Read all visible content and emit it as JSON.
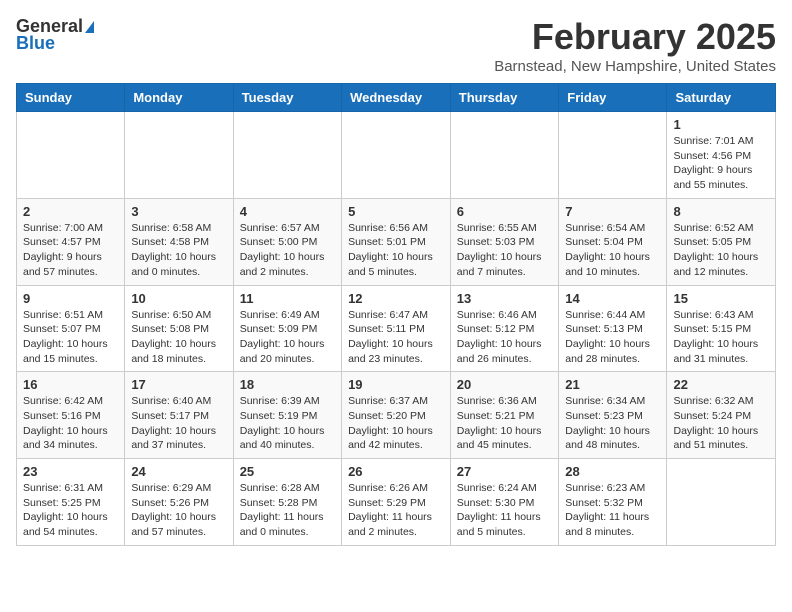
{
  "header": {
    "logo_general": "General",
    "logo_blue": "Blue",
    "title": "February 2025",
    "location": "Barnstead, New Hampshire, United States"
  },
  "days_of_week": [
    "Sunday",
    "Monday",
    "Tuesday",
    "Wednesday",
    "Thursday",
    "Friday",
    "Saturday"
  ],
  "weeks": [
    [
      {
        "day": "",
        "info": ""
      },
      {
        "day": "",
        "info": ""
      },
      {
        "day": "",
        "info": ""
      },
      {
        "day": "",
        "info": ""
      },
      {
        "day": "",
        "info": ""
      },
      {
        "day": "",
        "info": ""
      },
      {
        "day": "1",
        "info": "Sunrise: 7:01 AM\nSunset: 4:56 PM\nDaylight: 9 hours and 55 minutes."
      }
    ],
    [
      {
        "day": "2",
        "info": "Sunrise: 7:00 AM\nSunset: 4:57 PM\nDaylight: 9 hours and 57 minutes."
      },
      {
        "day": "3",
        "info": "Sunrise: 6:58 AM\nSunset: 4:58 PM\nDaylight: 10 hours and 0 minutes."
      },
      {
        "day": "4",
        "info": "Sunrise: 6:57 AM\nSunset: 5:00 PM\nDaylight: 10 hours and 2 minutes."
      },
      {
        "day": "5",
        "info": "Sunrise: 6:56 AM\nSunset: 5:01 PM\nDaylight: 10 hours and 5 minutes."
      },
      {
        "day": "6",
        "info": "Sunrise: 6:55 AM\nSunset: 5:03 PM\nDaylight: 10 hours and 7 minutes."
      },
      {
        "day": "7",
        "info": "Sunrise: 6:54 AM\nSunset: 5:04 PM\nDaylight: 10 hours and 10 minutes."
      },
      {
        "day": "8",
        "info": "Sunrise: 6:52 AM\nSunset: 5:05 PM\nDaylight: 10 hours and 12 minutes."
      }
    ],
    [
      {
        "day": "9",
        "info": "Sunrise: 6:51 AM\nSunset: 5:07 PM\nDaylight: 10 hours and 15 minutes."
      },
      {
        "day": "10",
        "info": "Sunrise: 6:50 AM\nSunset: 5:08 PM\nDaylight: 10 hours and 18 minutes."
      },
      {
        "day": "11",
        "info": "Sunrise: 6:49 AM\nSunset: 5:09 PM\nDaylight: 10 hours and 20 minutes."
      },
      {
        "day": "12",
        "info": "Sunrise: 6:47 AM\nSunset: 5:11 PM\nDaylight: 10 hours and 23 minutes."
      },
      {
        "day": "13",
        "info": "Sunrise: 6:46 AM\nSunset: 5:12 PM\nDaylight: 10 hours and 26 minutes."
      },
      {
        "day": "14",
        "info": "Sunrise: 6:44 AM\nSunset: 5:13 PM\nDaylight: 10 hours and 28 minutes."
      },
      {
        "day": "15",
        "info": "Sunrise: 6:43 AM\nSunset: 5:15 PM\nDaylight: 10 hours and 31 minutes."
      }
    ],
    [
      {
        "day": "16",
        "info": "Sunrise: 6:42 AM\nSunset: 5:16 PM\nDaylight: 10 hours and 34 minutes."
      },
      {
        "day": "17",
        "info": "Sunrise: 6:40 AM\nSunset: 5:17 PM\nDaylight: 10 hours and 37 minutes."
      },
      {
        "day": "18",
        "info": "Sunrise: 6:39 AM\nSunset: 5:19 PM\nDaylight: 10 hours and 40 minutes."
      },
      {
        "day": "19",
        "info": "Sunrise: 6:37 AM\nSunset: 5:20 PM\nDaylight: 10 hours and 42 minutes."
      },
      {
        "day": "20",
        "info": "Sunrise: 6:36 AM\nSunset: 5:21 PM\nDaylight: 10 hours and 45 minutes."
      },
      {
        "day": "21",
        "info": "Sunrise: 6:34 AM\nSunset: 5:23 PM\nDaylight: 10 hours and 48 minutes."
      },
      {
        "day": "22",
        "info": "Sunrise: 6:32 AM\nSunset: 5:24 PM\nDaylight: 10 hours and 51 minutes."
      }
    ],
    [
      {
        "day": "23",
        "info": "Sunrise: 6:31 AM\nSunset: 5:25 PM\nDaylight: 10 hours and 54 minutes."
      },
      {
        "day": "24",
        "info": "Sunrise: 6:29 AM\nSunset: 5:26 PM\nDaylight: 10 hours and 57 minutes."
      },
      {
        "day": "25",
        "info": "Sunrise: 6:28 AM\nSunset: 5:28 PM\nDaylight: 11 hours and 0 minutes."
      },
      {
        "day": "26",
        "info": "Sunrise: 6:26 AM\nSunset: 5:29 PM\nDaylight: 11 hours and 2 minutes."
      },
      {
        "day": "27",
        "info": "Sunrise: 6:24 AM\nSunset: 5:30 PM\nDaylight: 11 hours and 5 minutes."
      },
      {
        "day": "28",
        "info": "Sunrise: 6:23 AM\nSunset: 5:32 PM\nDaylight: 11 hours and 8 minutes."
      },
      {
        "day": "",
        "info": ""
      }
    ]
  ]
}
